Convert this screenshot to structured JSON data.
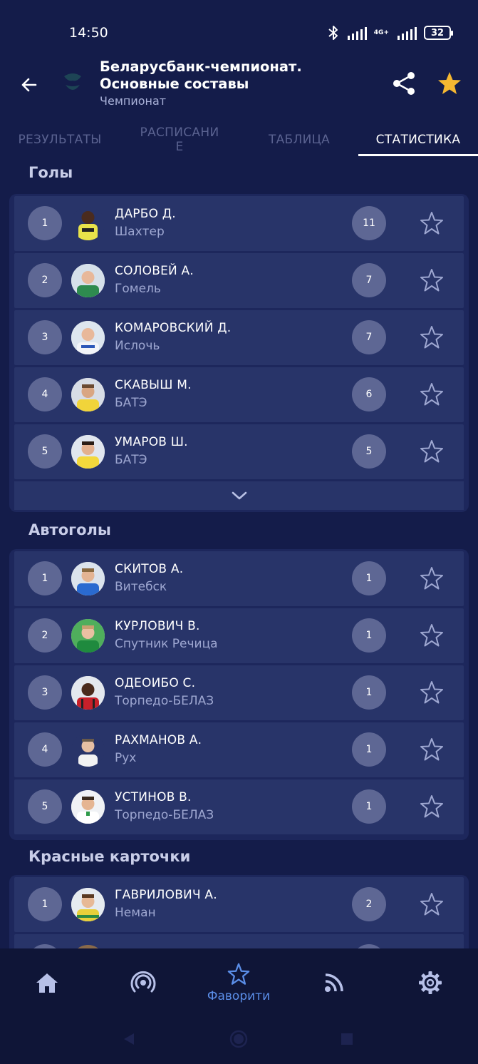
{
  "status_bar": {
    "time": "14:50",
    "network": "4G+",
    "battery": "32",
    "icons": [
      "bluetooth-icon",
      "signal-icon",
      "battery-icon"
    ]
  },
  "header": {
    "title_line1": "Беларусбанк-чемпионат.",
    "title_line2": "Основные составы",
    "subtitle": "Чемпионат",
    "icons": [
      "back-arrow-icon",
      "league-logo",
      "share-icon",
      "star-filled-icon"
    ]
  },
  "tabs": [
    {
      "label": "РЕЗУЛЬТАТЫ"
    },
    {
      "label": "РАСПИСАНИ\nЕ"
    },
    {
      "label": "ТАБЛИЦА"
    },
    {
      "label": "СТАТИСТИКА",
      "active": true
    }
  ],
  "sections": {
    "goals": {
      "title": "Голы",
      "rows": [
        {
          "rank": "1",
          "name": "ДАРБО Д.",
          "team": "Шахтер",
          "value": "11"
        },
        {
          "rank": "2",
          "name": "СОЛОВЕЙ А.",
          "team": "Гомель",
          "value": "7"
        },
        {
          "rank": "3",
          "name": "КОМАРОВСКИЙ Д.",
          "team": "Ислочь",
          "value": "7"
        },
        {
          "rank": "4",
          "name": "СКАВЫШ М.",
          "team": "БАТЭ",
          "value": "6"
        },
        {
          "rank": "5",
          "name": "УМАРОВ Ш.",
          "team": "БАТЭ",
          "value": "5"
        }
      ]
    },
    "own_goals": {
      "title": "Автоголы",
      "rows": [
        {
          "rank": "1",
          "name": "СКИТОВ А.",
          "team": "Витебск",
          "value": "1"
        },
        {
          "rank": "2",
          "name": "КУРЛОВИЧ В.",
          "team": "Спутник Речица",
          "value": "1"
        },
        {
          "rank": "3",
          "name": "ОДЕОИБО С.",
          "team": "Торпедо-БЕЛАЗ",
          "value": "1"
        },
        {
          "rank": "4",
          "name": "РАХМАНОВ А.",
          "team": "Рух",
          "value": "1"
        },
        {
          "rank": "5",
          "name": "УСТИНОВ В.",
          "team": "Торпедо-БЕЛАЗ",
          "value": "1"
        }
      ]
    },
    "red_cards": {
      "title": "Красные карточки",
      "rows": [
        {
          "rank": "1",
          "name": "ГАВРИЛОВИЧ А.",
          "team": "Неман",
          "value": "2"
        }
      ]
    }
  },
  "bottom_nav": [
    {
      "icon": "home-icon",
      "label": ""
    },
    {
      "icon": "live-broadcast-icon",
      "label": ""
    },
    {
      "icon": "star-outline-icon",
      "label": "Фаворити",
      "active": true
    },
    {
      "icon": "rss-feed-icon",
      "label": ""
    },
    {
      "icon": "settings-gear-icon",
      "label": ""
    }
  ],
  "system_nav": [
    "back-triangle-icon",
    "home-circle-icon",
    "recents-square-icon"
  ],
  "colors": {
    "background": "#141c4a",
    "card": "#1d275c",
    "row": "#283469",
    "badge": "#5e6794",
    "accent_star": "#f5b731",
    "nav_active": "#5b8ee8"
  }
}
